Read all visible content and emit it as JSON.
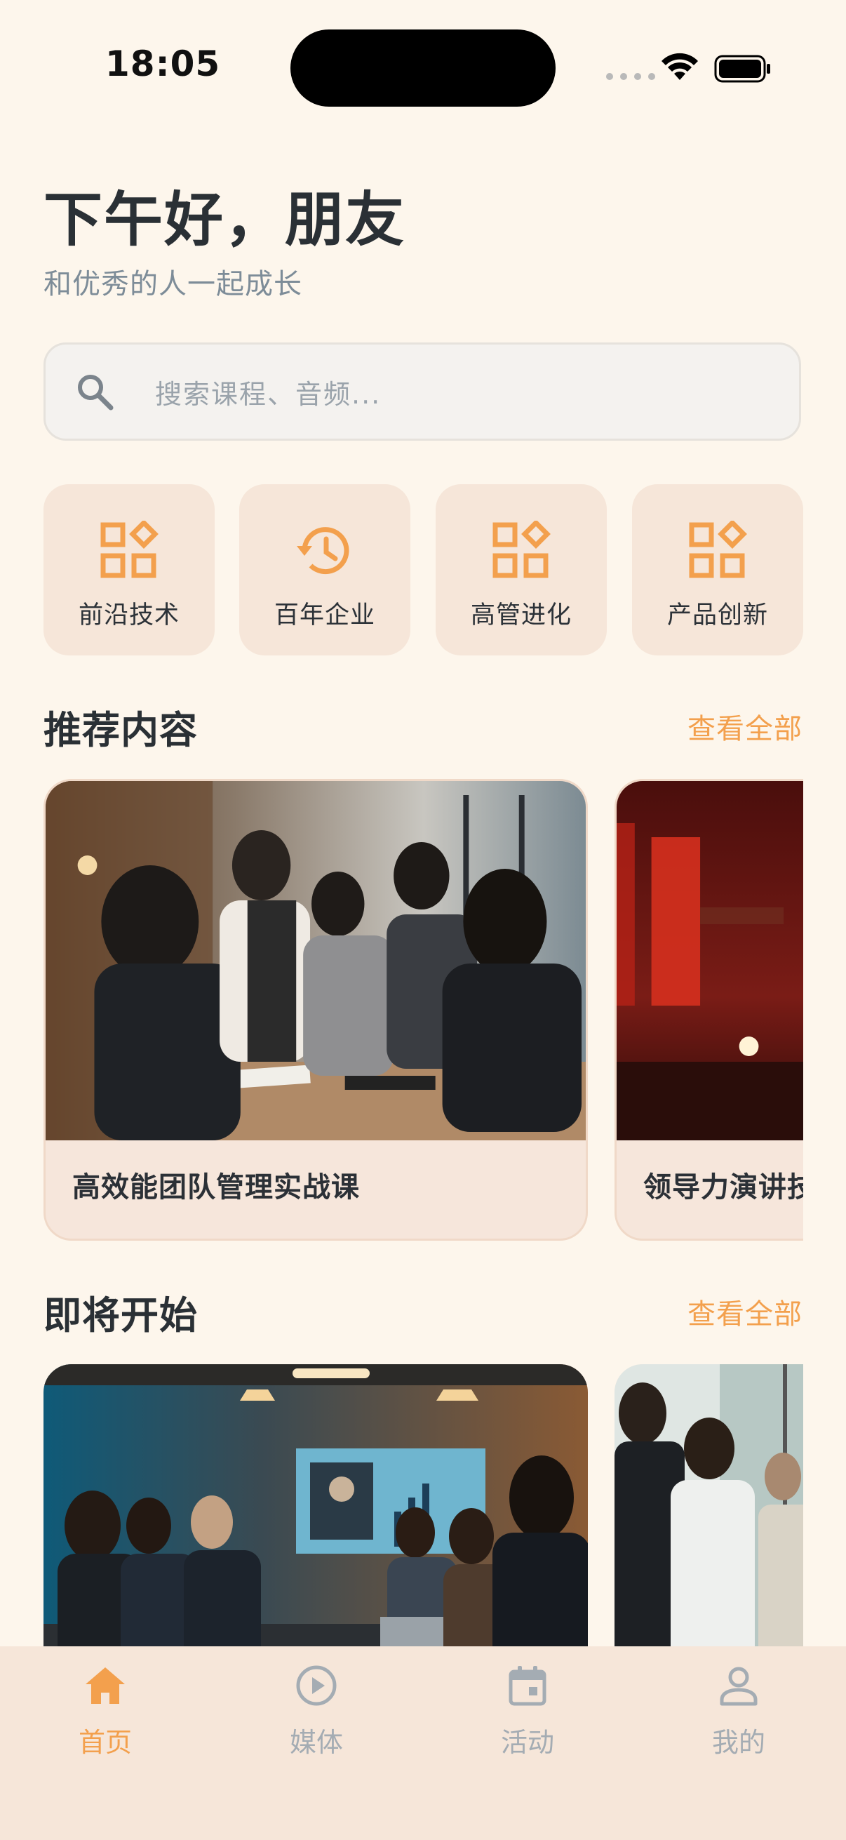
{
  "status_bar": {
    "time": "18:05"
  },
  "header": {
    "greeting": "下午好，朋友",
    "subtitle": "和优秀的人一起成长"
  },
  "search": {
    "placeholder": "搜索课程、音频..."
  },
  "categories": [
    {
      "label": "前沿技术",
      "icon": "grid-diamond-icon"
    },
    {
      "label": "百年企业",
      "icon": "history-clock-icon"
    },
    {
      "label": "高管进化",
      "icon": "grid-diamond-icon"
    },
    {
      "label": "产品创新",
      "icon": "grid-diamond-icon"
    }
  ],
  "recommended": {
    "title": "推荐内容",
    "see_all": "查看全部",
    "cards": [
      {
        "title": "高效能团队管理实战课"
      },
      {
        "title": "领导力演讲技"
      }
    ]
  },
  "upcoming": {
    "title": "即将开始",
    "see_all": "查看全部"
  },
  "tabs": [
    {
      "label": "首页",
      "icon": "home-icon",
      "active": true
    },
    {
      "label": "媒体",
      "icon": "play-circle-icon",
      "active": false
    },
    {
      "label": "活动",
      "icon": "calendar-icon",
      "active": false
    },
    {
      "label": "我的",
      "icon": "user-icon",
      "active": false
    }
  ],
  "colors": {
    "accent": "#f3a04d",
    "background": "#fdf6ec",
    "tile": "#f6e6d9"
  }
}
